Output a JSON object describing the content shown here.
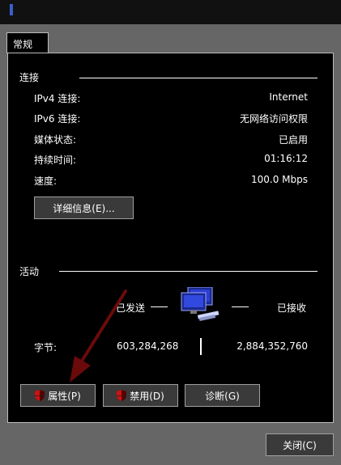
{
  "tab": {
    "label": "常规"
  },
  "connection": {
    "title": "连接",
    "rows": [
      {
        "label": "IPv4 连接:",
        "value": "Internet"
      },
      {
        "label": "IPv6 连接:",
        "value": "无网络访问权限"
      },
      {
        "label": "媒体状态:",
        "value": "已启用"
      },
      {
        "label": "持续时间:",
        "value": "01:16:12"
      },
      {
        "label": "速度:",
        "value": "100.0 Mbps"
      }
    ],
    "details_button": "详细信息(E)..."
  },
  "activity": {
    "title": "活动",
    "sent_label": "已发送",
    "received_label": "已接收",
    "bytes_label": "字节:",
    "bytes_sent": "603,284,268",
    "bytes_received": "2,884,352,760"
  },
  "buttons": {
    "properties": "属性(P)",
    "disable": "禁用(D)",
    "diagnose": "诊断(G)",
    "close": "关闭(C)"
  },
  "colors": {
    "annotation_arrow": "#6b0a0a",
    "shield_red": "#cc1111",
    "shield_dark": "#550000"
  }
}
